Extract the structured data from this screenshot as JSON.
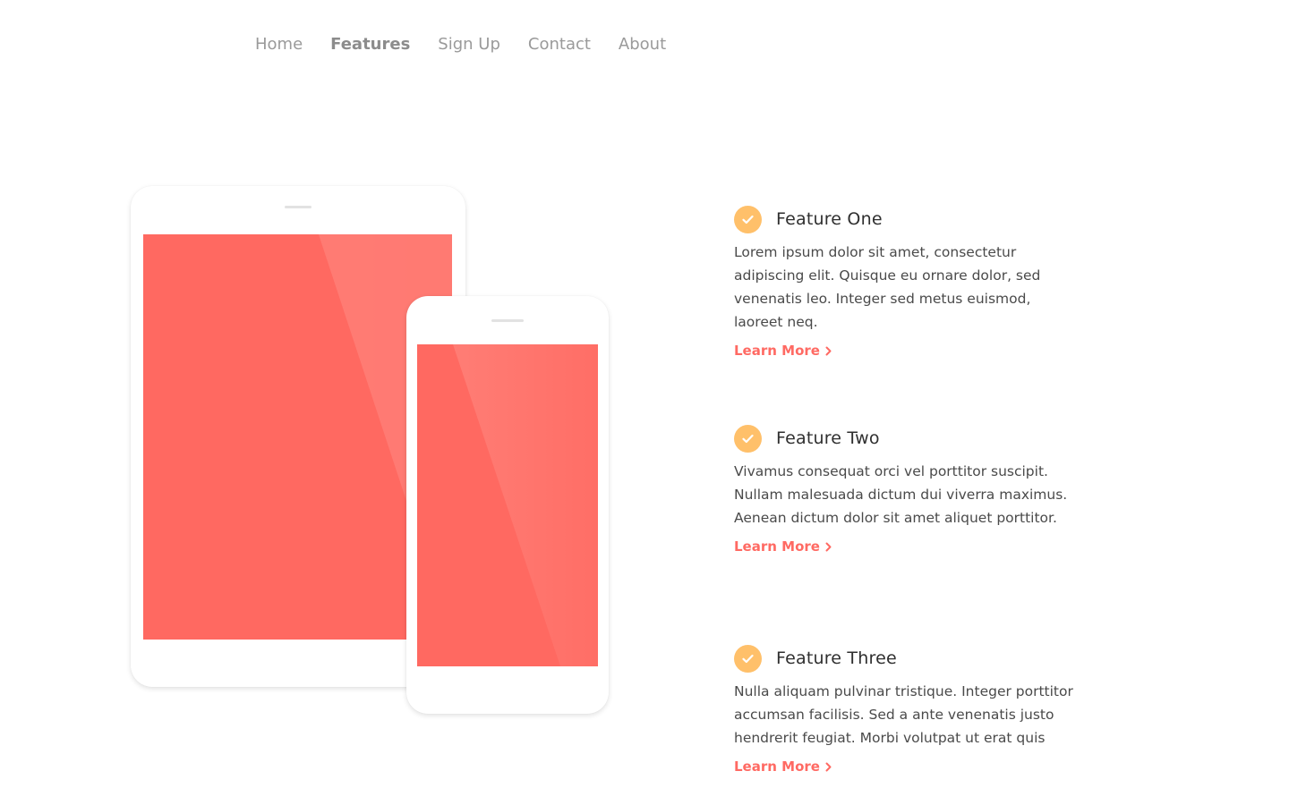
{
  "nav": {
    "items": [
      {
        "label": "Home",
        "active": false
      },
      {
        "label": "Features",
        "active": true
      },
      {
        "label": "Sign Up",
        "active": false
      },
      {
        "label": "Contact",
        "active": false
      },
      {
        "label": "About",
        "active": false
      }
    ]
  },
  "colors": {
    "accent": "#ff6a63",
    "screen": "#ff6961",
    "check_badge": "#ffc06a"
  },
  "icons": {
    "feature_icon": "check-circle-icon",
    "learn_more_icon": "chevron-right-icon"
  },
  "features": [
    {
      "title": "Feature One",
      "text": "Lorem ipsum dolor sit amet, consectetur adipiscing elit. Quisque eu ornare dolor, sed venenatis leo. Integer sed metus euismod, laoreet neq.",
      "link": "Learn More"
    },
    {
      "title": "Feature Two",
      "text": "Vivamus consequat orci vel porttitor suscipit. Nullam malesuada dictum dui viverra maximus. Aenean dictum dolor sit amet aliquet porttitor.",
      "link": "Learn More"
    },
    {
      "title": "Feature Three",
      "text": "Nulla aliquam pulvinar tristique. Integer porttitor accumsan facilisis. Sed a ante venenatis justo hendrerit feugiat. Morbi volutpat ut erat quis",
      "link": "Learn More"
    }
  ]
}
